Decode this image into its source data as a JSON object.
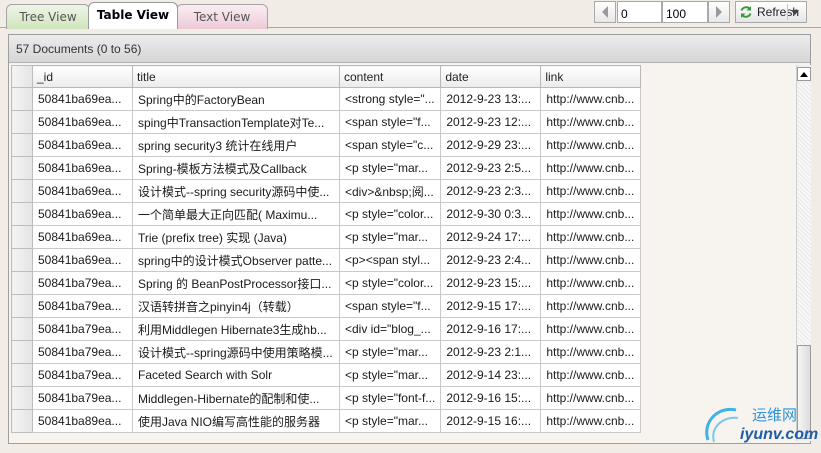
{
  "tabs": [
    {
      "label": "Tree View"
    },
    {
      "label": "Table View"
    },
    {
      "label": "Text View"
    }
  ],
  "pager": {
    "start": "0",
    "count": "100"
  },
  "refresh_label": "Refresh",
  "panel": {
    "header": "57 Documents (0 to 56)"
  },
  "grid": {
    "columns": [
      "_id",
      "title",
      "content",
      "date",
      "link"
    ],
    "rows": [
      [
        "50841ba69ea...",
        "Spring中的FactoryBean",
        "<strong style=\"...",
        "2012-9-23 13:...",
        "http://www.cnb..."
      ],
      [
        "50841ba69ea...",
        "sping中TransactionTemplate对Te...",
        "<span style=\"f...",
        "2012-9-23 12:...",
        "http://www.cnb..."
      ],
      [
        "50841ba69ea...",
        "spring security3 统计在线用户",
        "<span style=\"c...",
        "2012-9-29 23:...",
        "http://www.cnb..."
      ],
      [
        "50841ba69ea...",
        "Spring-模板方法模式及Callback",
        "<p style=\"mar...",
        "2012-9-23 2:5...",
        "http://www.cnb..."
      ],
      [
        "50841ba69ea...",
        "设计模式--spring security源码中使...",
        "<div>&nbsp;阅...",
        "2012-9-23 2:3...",
        "http://www.cnb..."
      ],
      [
        "50841ba69ea...",
        "一个简单最大正向匹配( Maximu...",
        "<p style=\"color...",
        "2012-9-30 0:3...",
        "http://www.cnb..."
      ],
      [
        "50841ba69ea...",
        "Trie (prefix tree) 实现 (Java)",
        "<p style=\"mar...",
        "2012-9-24 17:...",
        "http://www.cnb..."
      ],
      [
        "50841ba69ea...",
        "spring中的设计模式Observer patte...",
        "<p><span styl...",
        "2012-9-23 2:4...",
        "http://www.cnb..."
      ],
      [
        "50841ba79ea...",
        "Spring 的 BeanPostProcessor接口...",
        "<p style=\"color...",
        "2012-9-23 15:...",
        "http://www.cnb..."
      ],
      [
        "50841ba79ea...",
        "汉语转拼音之pinyin4j（转载）",
        "<span style=\"f...",
        "2012-9-15 17:...",
        "http://www.cnb..."
      ],
      [
        "50841ba79ea...",
        "利用Middlegen Hibernate3生成hb...",
        "<div id=\"blog_...",
        "2012-9-16 17:...",
        "http://www.cnb..."
      ],
      [
        "50841ba79ea...",
        "设计模式--spring源码中使用策略模...",
        "<p style=\"mar...",
        "2012-9-23 2:1...",
        "http://www.cnb..."
      ],
      [
        "50841ba79ea...",
        "Faceted Search with Solr",
        "<p style=\"mar...",
        "2012-9-14 23:...",
        "http://www.cnb..."
      ],
      [
        "50841ba79ea...",
        "Middlegen-Hibernate的配制和使...",
        "<p style=\"font-f...",
        "2012-9-16 15:...",
        "http://www.cnb..."
      ],
      [
        "50841ba89ea...",
        "使用Java NIO编写高性能的服务器",
        "<p style=\"mar...",
        "2012-9-15 16:...",
        "http://www.cnb..."
      ]
    ]
  },
  "watermark": {
    "cn": "运维网",
    "url": "iyunv.com"
  },
  "icons": {
    "prev": "chevron-left-icon",
    "next": "chevron-right-icon",
    "refresh": "refresh-icon"
  },
  "colors": {
    "tab_tree": "#cfe5bd",
    "tab_text": "#eccad8",
    "refresh_green": "#3a9a3a",
    "watermark_blue": "#2e93d6"
  }
}
